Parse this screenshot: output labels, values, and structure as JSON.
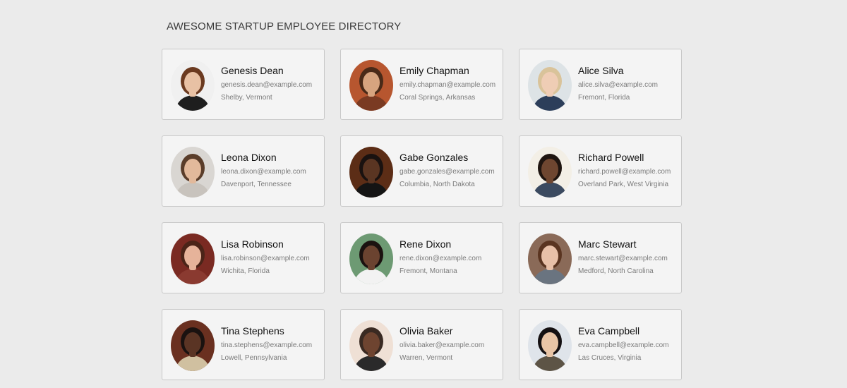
{
  "directory": {
    "title": "AWESOME STARTUP EMPLOYEE DIRECTORY"
  },
  "employees": [
    {
      "name": "Genesis Dean",
      "email": "genesis.dean@example.com",
      "location": "Shelby, Vermont",
      "bg": "#f0f0f0",
      "skin": "#e8c1a4",
      "hair": "#6b3a20",
      "shirt": "#1e1e1e"
    },
    {
      "name": "Emily Chapman",
      "email": "emily.chapman@example.com",
      "location": "Coral Springs, Arkansas",
      "bg": "#b7562f",
      "skin": "#d7a47f",
      "hair": "#4a2a18",
      "shirt": "#7a3a22"
    },
    {
      "name": "Alice Silva",
      "email": "alice.silva@example.com",
      "location": "Fremont, Florida",
      "bg": "#dde3e6",
      "skin": "#efcdb5",
      "hair": "#d9c39a",
      "shirt": "#2c3e5a"
    },
    {
      "name": "Leona Dixon",
      "email": "leona.dixon@example.com",
      "location": "Davenport, Tennessee",
      "bg": "#d9d6d2",
      "skin": "#e2b99b",
      "hair": "#5a3d2a",
      "shirt": "#c8c3bd"
    },
    {
      "name": "Gabe Gonzales",
      "email": "gabe.gonzales@example.com",
      "location": "Columbia, North Dakota",
      "bg": "#5c2d16",
      "skin": "#5a3522",
      "hair": "#1a1210",
      "shirt": "#141414"
    },
    {
      "name": "Richard Powell",
      "email": "richard.powell@example.com",
      "location": "Overland Park, West Virginia",
      "bg": "#f3efe6",
      "skin": "#6e4630",
      "hair": "#1f1510",
      "shirt": "#3b4a60"
    },
    {
      "name": "Lisa Robinson",
      "email": "lisa.robinson@example.com",
      "location": "Wichita, Florida",
      "bg": "#7a2a22",
      "skin": "#e6b39a",
      "hair": "#4b2418",
      "shirt": "#8a3a30"
    },
    {
      "name": "Rene Dixon",
      "email": "rene.dixon@example.com",
      "location": "Fremont, Montana",
      "bg": "#6d9a73",
      "skin": "#6b4330",
      "hair": "#1b1210",
      "shirt": "#f2f2f2"
    },
    {
      "name": "Marc Stewart",
      "email": "marc.stewart@example.com",
      "location": "Medford, North Carolina",
      "bg": "#8a6a58",
      "skin": "#e8c0a8",
      "hair": "#5a3420",
      "shirt": "#6a7480"
    },
    {
      "name": "Tina Stephens",
      "email": "tina.stephens@example.com",
      "location": "Lowell, Pennsylvania",
      "bg": "#6a3020",
      "skin": "#5a3424",
      "hair": "#1a1210",
      "shirt": "#d0c0a0"
    },
    {
      "name": "Olivia Baker",
      "email": "olivia.baker@example.com",
      "location": "Warren, Vermont",
      "bg": "#efe0d5",
      "skin": "#6e4430",
      "hair": "#3a2a22",
      "shirt": "#2a2a2a"
    },
    {
      "name": "Eva Campbell",
      "email": "eva.campbell@example.com",
      "location": "Las Cruces, Virginia",
      "bg": "#dfe4ea",
      "skin": "#e8c4a6",
      "hair": "#141012",
      "shirt": "#5d5446"
    }
  ]
}
